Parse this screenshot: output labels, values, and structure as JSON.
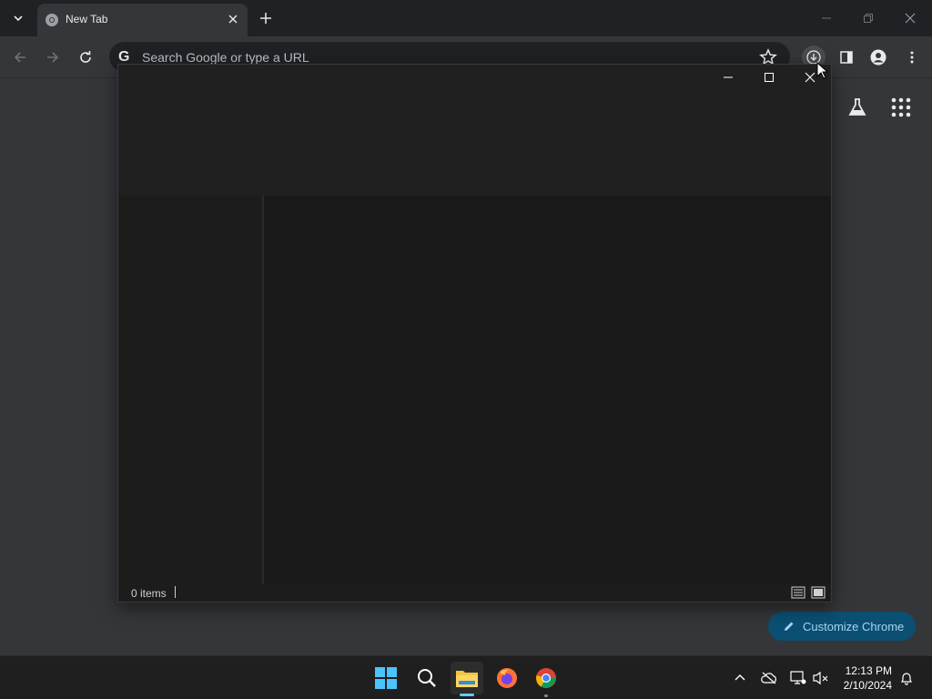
{
  "browser": {
    "tab": {
      "title": "New Tab"
    },
    "omnibox": {
      "placeholder": "Search Google or type a URL"
    },
    "customize_label": "Customize Chrome"
  },
  "explorer": {
    "status_count": "0 items"
  },
  "taskbar": {
    "apps": [
      "start",
      "search",
      "file-explorer",
      "firefox",
      "chrome"
    ],
    "clock": {
      "time": "12:13 PM",
      "date": "2/10/2024"
    }
  },
  "colors": {
    "chrome_bg": "#35363a",
    "tabstrip_bg": "#202124",
    "explorer_bg": "#1c1c1c",
    "accent": "#60cdff",
    "customize_bg": "#0b4f72"
  }
}
